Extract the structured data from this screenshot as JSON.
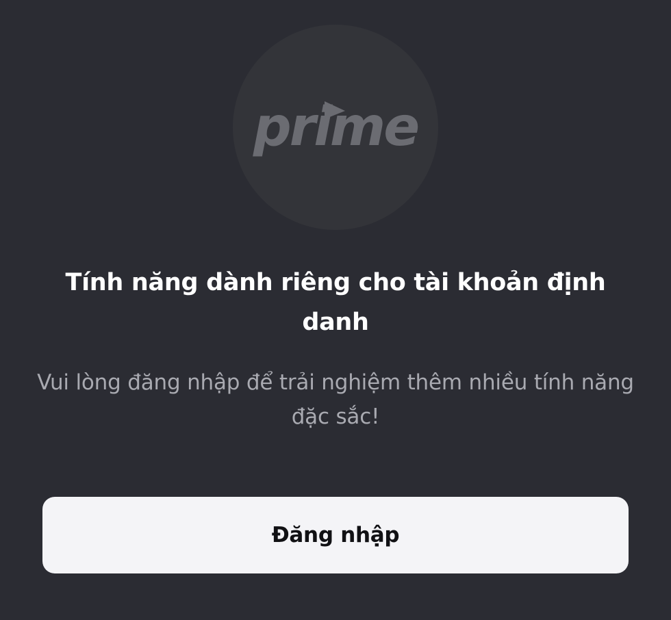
{
  "logo": {
    "text": "prime",
    "icon": "play-triangle-icon",
    "color": "#6b6c72",
    "circle_color": "#333439"
  },
  "content": {
    "title": "Tính năng dành riêng cho tài khoản định danh",
    "subtitle": "Vui lòng đăng nhập để trải nghiệm thêm nhiều tính năng đặc sắc!"
  },
  "actions": {
    "login_label": "Đăng nhập"
  },
  "colors": {
    "background": "#2b2c33",
    "title": "#ffffff",
    "subtitle": "#a9aab1",
    "button_bg": "#f4f4f7",
    "button_text": "#111114"
  }
}
